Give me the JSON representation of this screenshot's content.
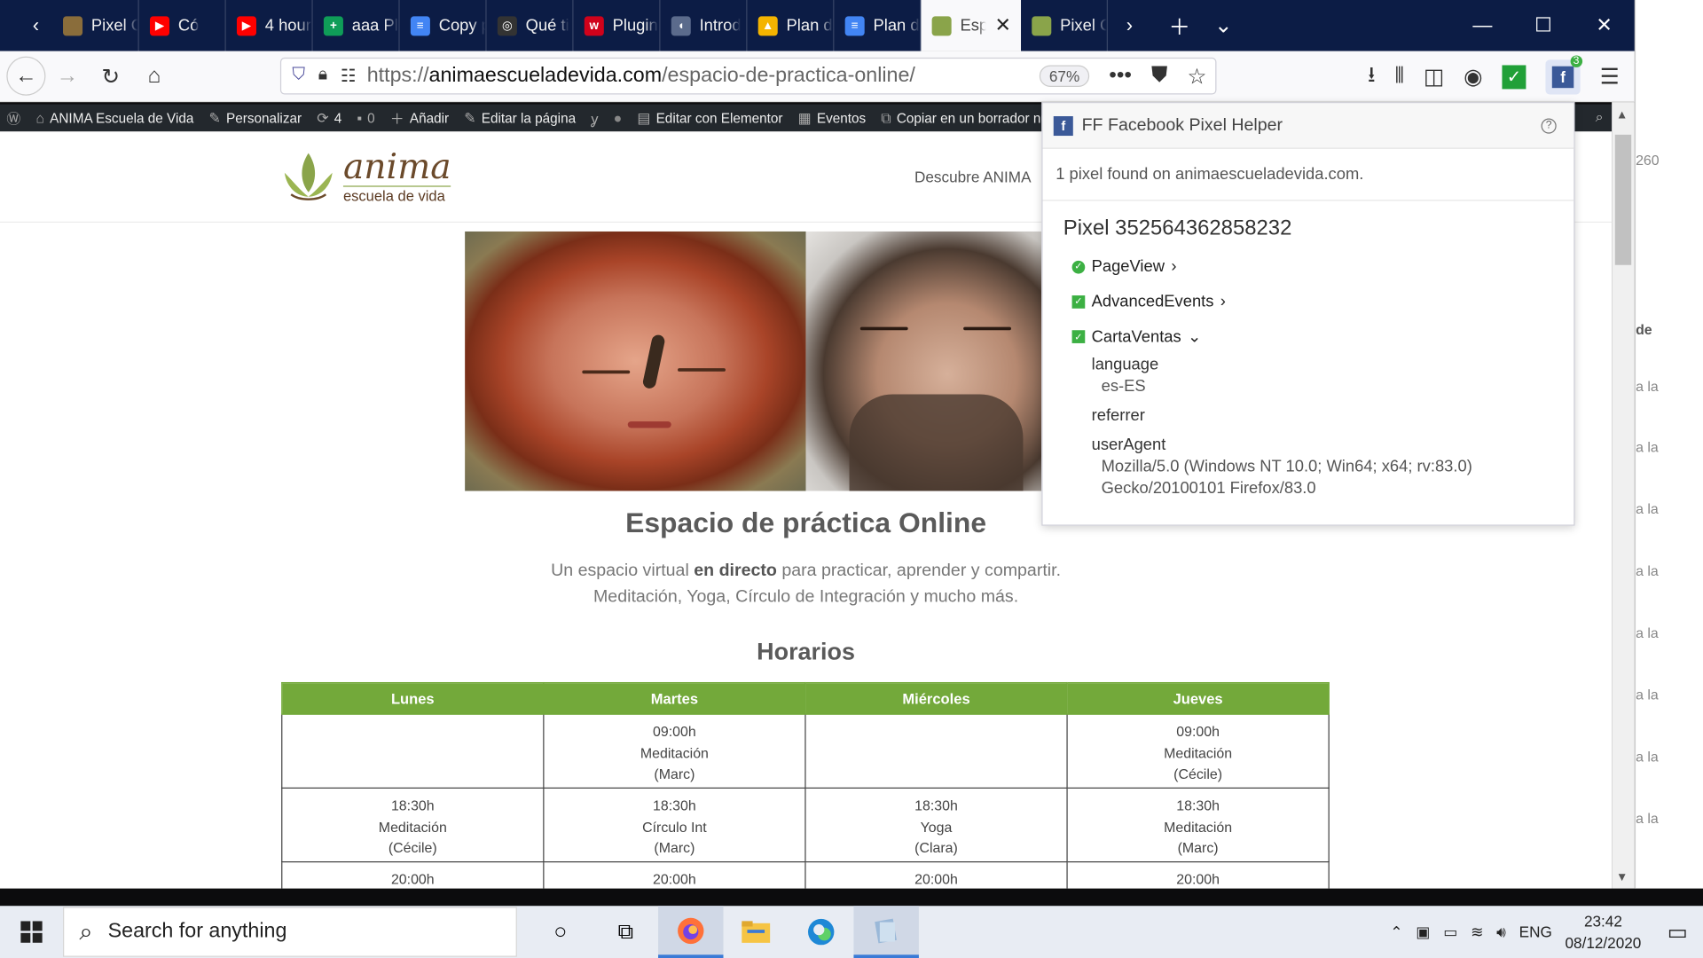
{
  "browser": {
    "tabs": [
      {
        "title": "Pixel C",
        "fav_color": "#8a6d3b",
        "fav_glyph": ""
      },
      {
        "title": "Có",
        "fav_color": "#ff0000",
        "fav_glyph": "▶"
      },
      {
        "title": "4 hour",
        "fav_color": "#ff0000",
        "fav_glyph": "▶"
      },
      {
        "title": "aaa Pl",
        "fav_color": "#0f9d58",
        "fav_glyph": "+"
      },
      {
        "title": "Copy p",
        "fav_color": "#4285f4",
        "fav_glyph": "≡"
      },
      {
        "title": "Qué ti",
        "fav_color": "#333333",
        "fav_glyph": "◎"
      },
      {
        "title": "Plugin",
        "fav_color": "#d0021b",
        "fav_glyph": "w"
      },
      {
        "title": "Introd",
        "fav_color": "#5b6b8c",
        "fav_glyph": "◖"
      },
      {
        "title": "Plan d",
        "fav_color": "#f4b400",
        "fav_glyph": "▲"
      },
      {
        "title": "Plan d",
        "fav_color": "#4285f4",
        "fav_glyph": "≡"
      },
      {
        "title": "Esp",
        "fav_color": "#8aa44a",
        "fav_glyph": "",
        "active": true
      },
      {
        "title": "Pixel C",
        "fav_color": "#8aa44a",
        "fav_glyph": ""
      }
    ],
    "url_prefix": "https://",
    "url_domain": "animaescueladevida.com",
    "url_path": "/espacio-de-practica-online/",
    "zoom": "67%"
  },
  "wpbar": {
    "site_name": "ANIMA Escuela de Vida",
    "customize": "Personalizar",
    "updates": "4",
    "comments": "0",
    "add_new": "Añadir",
    "edit_page": "Editar la página",
    "edit_elementor": "Editar con Elementor",
    "events": "Eventos",
    "copy_draft": "Copiar en un borrador nuevo"
  },
  "site": {
    "logo_word": "anima",
    "logo_sub": "escuela de vida",
    "nav_item": "Descubre ANIMA",
    "title": "Espacio de práctica Online",
    "subtitle_pre": "Un espacio virtual ",
    "subtitle_bold": "en directo",
    "subtitle_post": " para practicar, aprender y compartir.",
    "subtitle_line2": "Meditación, Yoga, Círculo de Integración y mucho más.",
    "schedule_heading": "Horarios",
    "days": [
      "Lunes",
      "Martes",
      "Miércoles",
      "Jueves"
    ],
    "rows": [
      [
        {
          "time": "",
          "activity": "",
          "teacher": ""
        },
        {
          "time": "09:00h",
          "activity": "Meditación",
          "teacher": "(Marc)"
        },
        {
          "time": "",
          "activity": "",
          "teacher": ""
        },
        {
          "time": "09:00h",
          "activity": "Meditación",
          "teacher": "(Cécile)"
        }
      ],
      [
        {
          "time": "18:30h",
          "activity": "Meditación",
          "teacher": "(Cécile)"
        },
        {
          "time": "18:30h",
          "activity": "Círculo Int",
          "teacher": "(Marc)"
        },
        {
          "time": "18:30h",
          "activity": "Yoga",
          "teacher": "(Clara)"
        },
        {
          "time": "18:30h",
          "activity": "Meditación",
          "teacher": "(Marc)"
        }
      ],
      [
        {
          "time": "20:00h",
          "activity": "",
          "teacher": ""
        },
        {
          "time": "20:00h",
          "activity": "",
          "teacher": ""
        },
        {
          "time": "20:00h",
          "activity": "",
          "teacher": ""
        },
        {
          "time": "20:00h",
          "activity": "",
          "teacher": ""
        }
      ]
    ],
    "accent_color": "#73a93a"
  },
  "pixel_helper": {
    "title": "FF Facebook Pixel Helper",
    "found_text": "1 pixel found on animaescueladevida.com.",
    "pixel_label": "Pixel 352564362858232",
    "events": [
      "PageView",
      "AdvancedEvents",
      "CartaVentas"
    ],
    "params": [
      {
        "key": "language",
        "value": "es-ES"
      },
      {
        "key": "referrer",
        "value": ""
      },
      {
        "key": "userAgent",
        "value_line1": "Mozilla/5.0 (Windows NT 10.0; Win64; x64; rv:83.0)",
        "value_line2": "Gecko/20100101 Firefox/83.0"
      }
    ],
    "badge_count": "3"
  },
  "behind_window": {
    "snippets": [
      "260",
      "de",
      "a la",
      "a la",
      "a la",
      "a la",
      "a la",
      "a la",
      "a la",
      "a la"
    ]
  },
  "taskbar": {
    "search_placeholder": "Search for anything",
    "language": "ENG",
    "time": "23:42",
    "date": "08/12/2020"
  }
}
